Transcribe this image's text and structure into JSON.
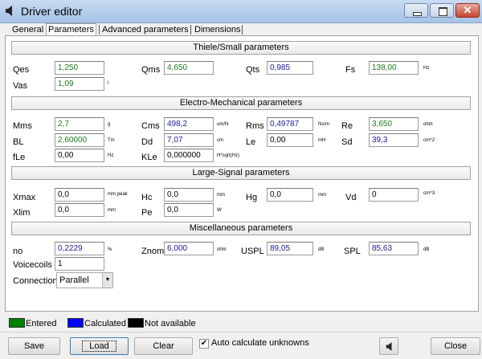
{
  "window": {
    "title": "Driver editor"
  },
  "tabs": [
    {
      "label": "General"
    },
    {
      "label": "Parameters"
    },
    {
      "label": "Advanced parameters"
    },
    {
      "label": "Dimensions"
    }
  ],
  "sections": {
    "thiele": "Thiele/Small parameters",
    "electro": "Electro-Mechanical parameters",
    "large": "Large-Signal parameters",
    "misc": "Miscellaneous parameters"
  },
  "params": {
    "qes": {
      "label": "Qes",
      "value": "1,250",
      "unit": "",
      "state": "entered"
    },
    "qms": {
      "label": "Qms",
      "value": "4,650",
      "unit": "",
      "state": "entered"
    },
    "qts": {
      "label": "Qts",
      "value": "0,985",
      "unit": "",
      "state": "calculated"
    },
    "fs": {
      "label": "Fs",
      "value": "138,00",
      "unit": "Hz",
      "state": "entered"
    },
    "vas": {
      "label": "Vas",
      "value": "1,09",
      "unit": "l",
      "state": "entered"
    },
    "mms": {
      "label": "Mms",
      "value": "2,7",
      "unit": "g",
      "state": "entered"
    },
    "cms": {
      "label": "Cms",
      "value": "498,2",
      "unit": "um/N",
      "state": "calculated"
    },
    "rms": {
      "label": "Rms",
      "value": "0,49787",
      "unit": "Ns/m",
      "state": "calculated"
    },
    "re": {
      "label": "Re",
      "value": "3,650",
      "unit": "ohm",
      "state": "entered"
    },
    "bl": {
      "label": "BL",
      "value": "2,60000",
      "unit": "Tm",
      "state": "entered"
    },
    "dd": {
      "label": "Dd",
      "value": "7,07",
      "unit": "cm",
      "state": "calculated"
    },
    "le": {
      "label": "Le",
      "value": "0,00",
      "unit": "mH",
      "state": "na"
    },
    "sd": {
      "label": "Sd",
      "value": "39,3",
      "unit": "cm^2",
      "state": "calculated"
    },
    "fle": {
      "label": "fLe",
      "value": "0,00",
      "unit": "Hz",
      "state": "na"
    },
    "kle": {
      "label": "KLe",
      "value": "0,000000",
      "unit": "H*sqrt(Hz)",
      "state": "na"
    },
    "xmax": {
      "label": "Xmax",
      "value": "0,0",
      "unit": "mm  peak",
      "state": "na"
    },
    "hc": {
      "label": "Hc",
      "value": "0,0",
      "unit": "mm",
      "state": "na"
    },
    "hg": {
      "label": "Hg",
      "value": "0,0",
      "unit": "mm",
      "state": "na"
    },
    "vd": {
      "label": "Vd",
      "value": "0",
      "unit": "cm^3",
      "state": "na"
    },
    "xlim": {
      "label": "Xlim",
      "value": "0,0",
      "unit": "mm",
      "state": "na"
    },
    "pe": {
      "label": "Pe",
      "value": "0,0",
      "unit": "W",
      "state": "na"
    },
    "no": {
      "label": "no",
      "value": "0,2229",
      "unit": "%",
      "state": "calculated"
    },
    "znom": {
      "label": "Znom",
      "value": "6,000",
      "unit": "ohm",
      "state": "calculated"
    },
    "uspl": {
      "label": "USPL",
      "value": "89,05",
      "unit": "dB",
      "state": "calculated"
    },
    "spl": {
      "label": "SPL",
      "value": "85,63",
      "unit": "dB",
      "state": "calculated"
    },
    "voicecoils": {
      "label": "Voicecoils",
      "value": "1",
      "state": "na"
    }
  },
  "connection": {
    "label": "Connection",
    "value": "Parallel"
  },
  "legend": {
    "entered": {
      "label": "Entered",
      "color": "#008000"
    },
    "calculated": {
      "label": "Calculated",
      "color": "#0000ff"
    },
    "na": {
      "label": "Not available",
      "color": "#000000"
    }
  },
  "buttons": {
    "save": "Save",
    "load": "Load",
    "clear": "Clear",
    "close": "Close"
  },
  "auto_calc": {
    "label": "Auto calculate unknowns",
    "checked": true,
    "mark": "✔"
  },
  "icons": {
    "app": "speaker-icon",
    "bottom": "speaker-icon"
  }
}
